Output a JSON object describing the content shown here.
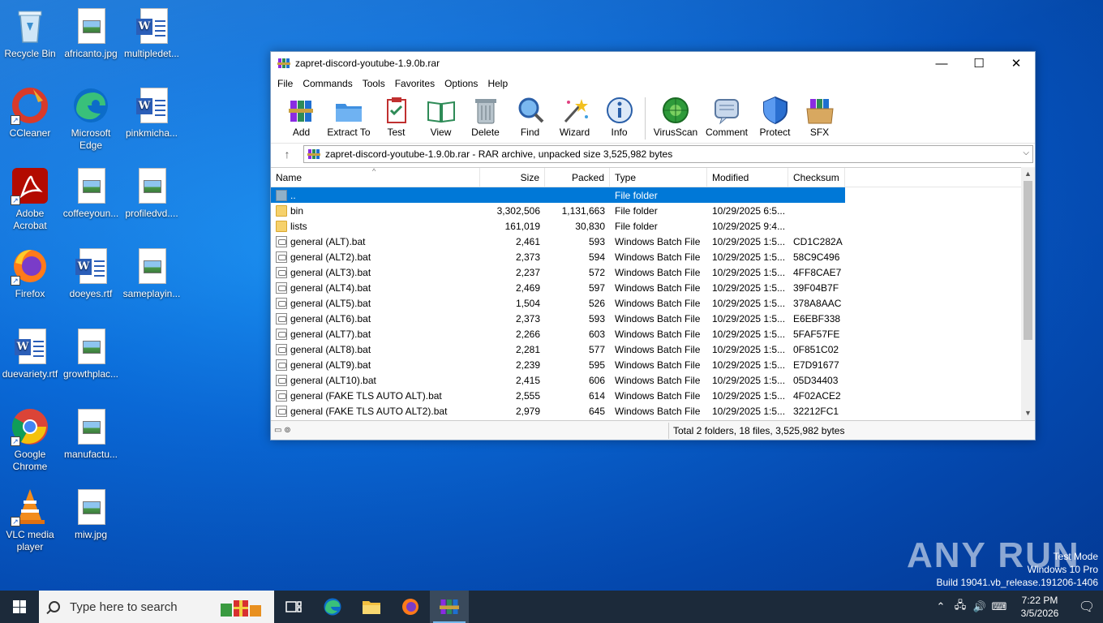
{
  "desktop": {
    "icons": [
      {
        "label": "Recycle Bin"
      },
      {
        "label": "africanto.jpg"
      },
      {
        "label": "multipledet..."
      },
      {
        "label": "CCleaner"
      },
      {
        "label": "Microsoft Edge"
      },
      {
        "label": "pinkmicha..."
      },
      {
        "label": "Adobe Acrobat"
      },
      {
        "label": "coffeeyoun..."
      },
      {
        "label": "profiledvd...."
      },
      {
        "label": "Firefox"
      },
      {
        "label": "doeyes.rtf"
      },
      {
        "label": "sameplayin..."
      },
      {
        "label": "duevariety.rtf"
      },
      {
        "label": "growthplac..."
      },
      {
        "label": "Google Chrome"
      },
      {
        "label": "manufactu..."
      },
      {
        "label": "VLC media player"
      },
      {
        "label": "miw.jpg"
      }
    ]
  },
  "window": {
    "title": "zapret-discord-youtube-1.9.0b.rar",
    "controls": {
      "minimize": "—",
      "maximize": "☐",
      "close": "✕"
    },
    "menu": [
      "File",
      "Commands",
      "Tools",
      "Favorites",
      "Options",
      "Help"
    ],
    "toolbar": [
      "Add",
      "Extract To",
      "Test",
      "View",
      "Delete",
      "Find",
      "Wizard",
      "Info",
      "VirusScan",
      "Comment",
      "Protect",
      "SFX"
    ],
    "address": "zapret-discord-youtube-1.9.0b.rar - RAR archive, unpacked size 3,525,982 bytes",
    "columns": {
      "name": "Name",
      "size": "Size",
      "packed": "Packed",
      "type": "Type",
      "modified": "Modified",
      "checksum": "Checksum"
    },
    "files": [
      {
        "name": "..",
        "size": "",
        "packed": "",
        "type": "File folder",
        "modified": "",
        "checksum": "",
        "kind": "up"
      },
      {
        "name": "bin",
        "size": "3,302,506",
        "packed": "1,131,663",
        "type": "File folder",
        "modified": "10/29/2025 6:5...",
        "checksum": "",
        "kind": "folder"
      },
      {
        "name": "lists",
        "size": "161,019",
        "packed": "30,830",
        "type": "File folder",
        "modified": "10/29/2025 9:4...",
        "checksum": "",
        "kind": "folder"
      },
      {
        "name": "general (ALT).bat",
        "size": "2,461",
        "packed": "593",
        "type": "Windows Batch File",
        "modified": "10/29/2025 1:5...",
        "checksum": "CD1C282A",
        "kind": "bat"
      },
      {
        "name": "general (ALT2).bat",
        "size": "2,373",
        "packed": "594",
        "type": "Windows Batch File",
        "modified": "10/29/2025 1:5...",
        "checksum": "58C9C496",
        "kind": "bat"
      },
      {
        "name": "general (ALT3).bat",
        "size": "2,237",
        "packed": "572",
        "type": "Windows Batch File",
        "modified": "10/29/2025 1:5...",
        "checksum": "4FF8CAE7",
        "kind": "bat"
      },
      {
        "name": "general (ALT4).bat",
        "size": "2,469",
        "packed": "597",
        "type": "Windows Batch File",
        "modified": "10/29/2025 1:5...",
        "checksum": "39F04B7F",
        "kind": "bat"
      },
      {
        "name": "general (ALT5).bat",
        "size": "1,504",
        "packed": "526",
        "type": "Windows Batch File",
        "modified": "10/29/2025 1:5...",
        "checksum": "378A8AAC",
        "kind": "bat"
      },
      {
        "name": "general (ALT6).bat",
        "size": "2,373",
        "packed": "593",
        "type": "Windows Batch File",
        "modified": "10/29/2025 1:5...",
        "checksum": "E6EBF338",
        "kind": "bat"
      },
      {
        "name": "general (ALT7).bat",
        "size": "2,266",
        "packed": "603",
        "type": "Windows Batch File",
        "modified": "10/29/2025 1:5...",
        "checksum": "5FAF57FE",
        "kind": "bat"
      },
      {
        "name": "general (ALT8).bat",
        "size": "2,281",
        "packed": "577",
        "type": "Windows Batch File",
        "modified": "10/29/2025 1:5...",
        "checksum": "0F851C02",
        "kind": "bat"
      },
      {
        "name": "general (ALT9).bat",
        "size": "2,239",
        "packed": "595",
        "type": "Windows Batch File",
        "modified": "10/29/2025 1:5...",
        "checksum": "E7D91677",
        "kind": "bat"
      },
      {
        "name": "general (ALT10).bat",
        "size": "2,415",
        "packed": "606",
        "type": "Windows Batch File",
        "modified": "10/29/2025 1:5...",
        "checksum": "05D34403",
        "kind": "bat"
      },
      {
        "name": "general (FAKE TLS AUTO ALT).bat",
        "size": "2,555",
        "packed": "614",
        "type": "Windows Batch File",
        "modified": "10/29/2025 1:5...",
        "checksum": "4F02ACE2",
        "kind": "bat"
      },
      {
        "name": "general (FAKE TLS AUTO ALT2).bat",
        "size": "2,979",
        "packed": "645",
        "type": "Windows Batch File",
        "modified": "10/29/2025 1:5...",
        "checksum": "32212FC1",
        "kind": "bat"
      }
    ],
    "status": "Total 2 folders, 18 files, 3,525,982 bytes"
  },
  "taskbar": {
    "search_placeholder": "Type here to search",
    "time": "7:22 PM",
    "date": "3/5/2026"
  },
  "watermark": {
    "brand": "ANY RUN",
    "line1": "Test Mode",
    "line2": "Windows 10 Pro",
    "line3": "Build 19041.vb_release.191206-1406"
  },
  "colors": {
    "selection": "#0078d7",
    "taskbar": "#1c2a3a",
    "folder": "#f6d16b"
  }
}
